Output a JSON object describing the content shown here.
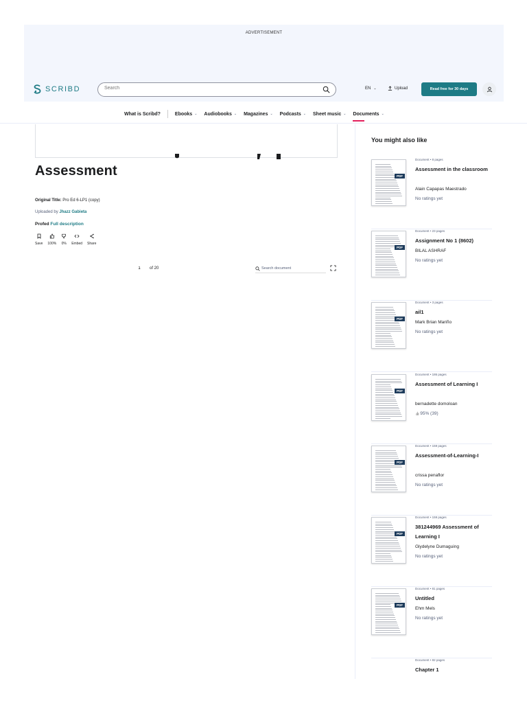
{
  "ad": {
    "label": "ADVERTISEMENT"
  },
  "header": {
    "logo_text": "SCRIBD",
    "search_placeholder": "Search",
    "lang": "EN",
    "upload": "Upload",
    "read_free": "Read free for 30 days"
  },
  "nav": {
    "items": [
      {
        "label": "What is Scribd?",
        "has_menu": false
      },
      {
        "label": "Ebooks",
        "has_menu": true
      },
      {
        "label": "Audiobooks",
        "has_menu": true
      },
      {
        "label": "Magazines",
        "has_menu": true
      },
      {
        "label": "Podcasts",
        "has_menu": true
      },
      {
        "label": "Sheet music",
        "has_menu": true
      },
      {
        "label": "Documents",
        "has_menu": true,
        "active": true
      }
    ]
  },
  "document": {
    "title": "Assessment",
    "original_title_label": "Original Title:",
    "original_title": "Pro Ed 6-LP1 (copy)",
    "uploaded_by_label": "Uploaded by",
    "uploader": "Jhazz Gabieta",
    "profile": "Profed",
    "full_description": "Full description",
    "actions": [
      {
        "label": "Save",
        "icon": "bookmark-icon"
      },
      {
        "label": "100%",
        "icon": "thumbs-up-icon"
      },
      {
        "label": "0%",
        "icon": "thumbs-down-icon"
      },
      {
        "label": "Embed",
        "icon": "embed-icon"
      },
      {
        "label": "Share",
        "icon": "share-icon"
      }
    ],
    "page_current": "1",
    "page_total": "of 20",
    "search_doc_placeholder": "Search document"
  },
  "sidebar": {
    "heading": "You might also like",
    "cards": [
      {
        "meta": "Document • 8 pages",
        "title": "Assessment in the classroom",
        "author": "Alain Capapas Maestrado",
        "rating": "No ratings yet"
      },
      {
        "meta": "Document • 23 pages",
        "title": "Assignment No 1 (8602)",
        "author": "BILAL ASHRAF",
        "rating": "No ratings yet"
      },
      {
        "meta": "Document • 3 pages",
        "title": "ail1",
        "author": "Mark Brian Mariño",
        "rating": "No ratings yet"
      },
      {
        "meta": "Document • 186 pages",
        "title": "Assessment of Learning I",
        "author": "bernadette domoloan",
        "rating": "95% (39)"
      },
      {
        "meta": "Document • 159 pages",
        "title": "Assessment-of-Learning-I",
        "author": "crissa penaflor",
        "rating": "No ratings yet"
      },
      {
        "meta": "Document • 159 pages",
        "title": "381244969 Assessment of Learning I",
        "author": "Glydelyne Dumaguing",
        "rating": "No ratings yet"
      },
      {
        "meta": "Document • 81 pages",
        "title": "Untitled",
        "author": "Ehm Mels",
        "rating": "No ratings yet"
      },
      {
        "meta": "Document • 82 pages",
        "title": "Chapter 1",
        "author": "",
        "rating": ""
      }
    ]
  },
  "colors": {
    "brand": "#1e7b85",
    "accent": "#e31e5b",
    "pdf_badge": "#1d3b5b"
  }
}
